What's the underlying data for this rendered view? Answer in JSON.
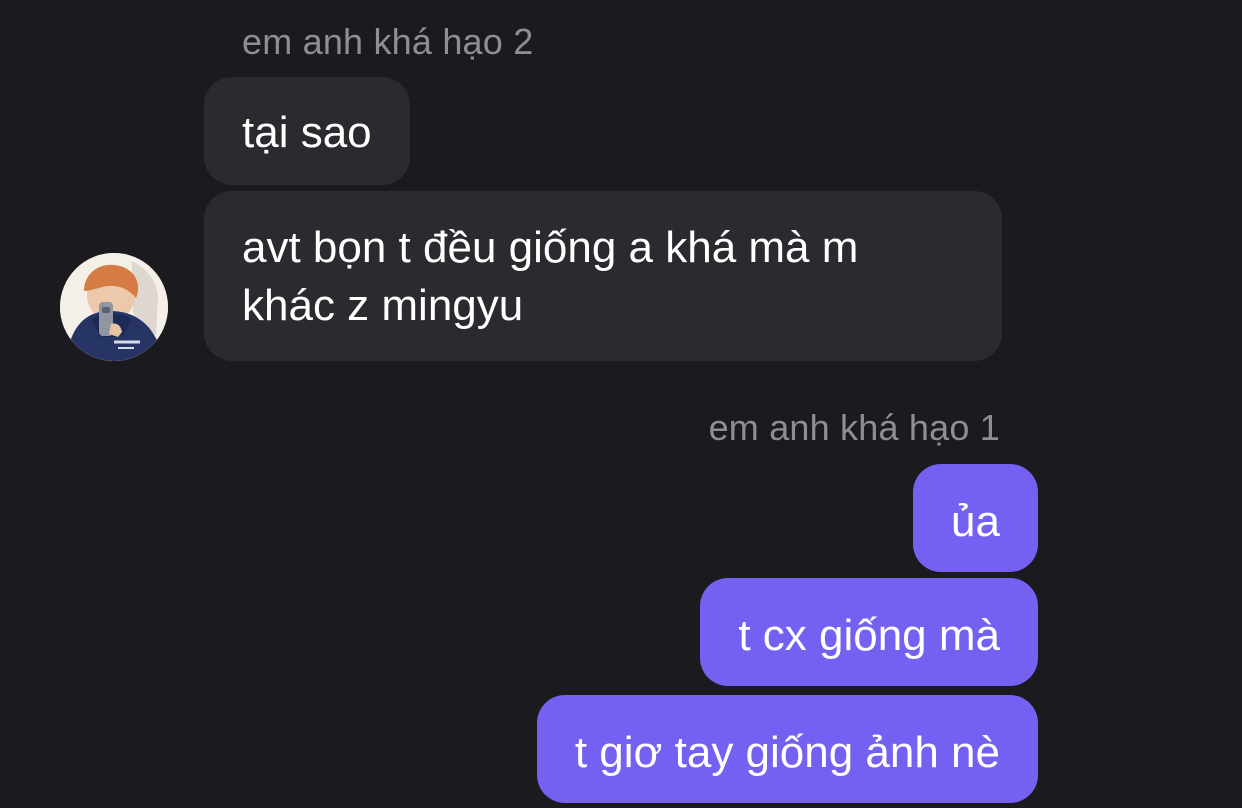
{
  "conversation": {
    "incoming_sender": "em anh khá hạo 2",
    "outgoing_sender": "em anh khá hạo 1",
    "incoming_messages": [
      "tại sao",
      "avt bọn t đều giống a khá mà m khác z mingyu"
    ],
    "incoming_message_lines": [
      [
        "tại sao"
      ],
      [
        "avt bọn t đều giống a khá mà m",
        "khác z mingyu"
      ]
    ],
    "outgoing_messages": [
      "ủa",
      "t cx giống mà",
      "t giơ tay giống ảnh nè"
    ]
  },
  "avatar": {
    "icon": "profile-photo-avatar"
  },
  "colors": {
    "background": "#1b1a1f",
    "incoming_bubble": "#2b2b2f",
    "outgoing_bubble": "#7561f1",
    "sender_text": "#8e8e93",
    "message_text": "#ffffff"
  }
}
